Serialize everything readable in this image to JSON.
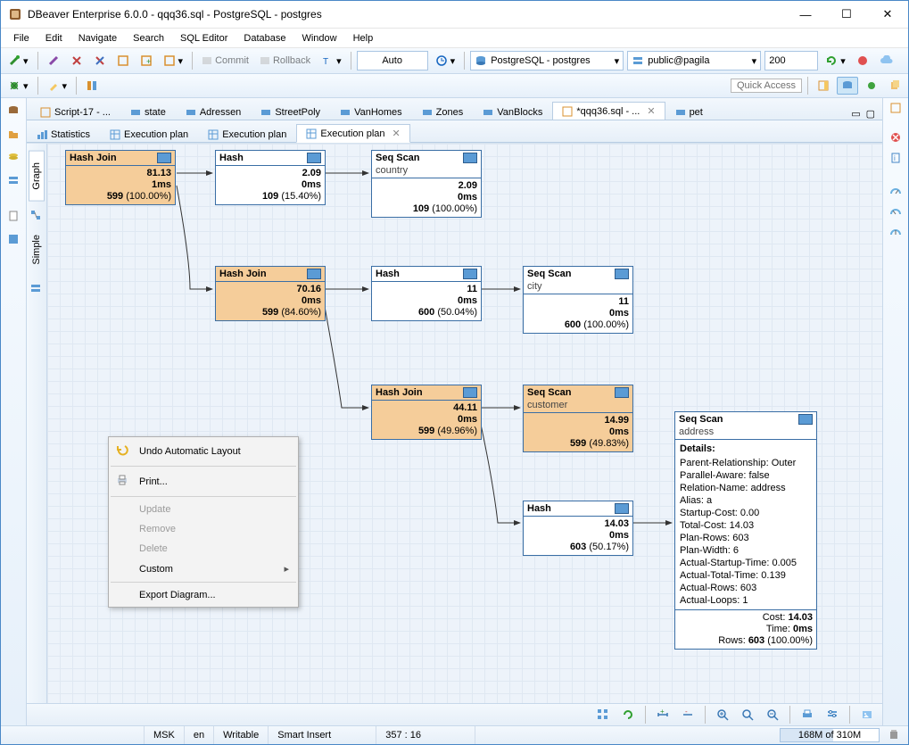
{
  "title": "DBeaver Enterprise 6.0.0 - qqq36.sql - PostgreSQL - postgres",
  "menu": [
    "File",
    "Edit",
    "Navigate",
    "Search",
    "SQL Editor",
    "Database",
    "Window",
    "Help"
  ],
  "toolbar": {
    "commit": "Commit",
    "rollback": "Rollback",
    "auto": "Auto",
    "datasource": "PostgreSQL - postgres",
    "schema": "public@pagila",
    "limit": "200"
  },
  "quick_access": "Quick Access",
  "editorTabs": [
    {
      "label": "Script-17 - ..."
    },
    {
      "label": "state"
    },
    {
      "label": "Adressen"
    },
    {
      "label": "StreetPoly"
    },
    {
      "label": "VanHomes"
    },
    {
      "label": "Zones"
    },
    {
      "label": "VanBlocks"
    },
    {
      "label": "*qqq36.sql - ...",
      "active": true,
      "closable": true
    },
    {
      "label": "pet"
    }
  ],
  "subTabs": [
    {
      "label": "Statistics"
    },
    {
      "label": "Execution plan"
    },
    {
      "label": "Execution plan"
    },
    {
      "label": "Execution plan",
      "active": true,
      "closable": true
    }
  ],
  "vert": {
    "graph": "Graph",
    "simple": "Simple"
  },
  "context": {
    "undo": "Undo Automatic Layout",
    "print": "Print...",
    "update": "Update",
    "remove": "Remove",
    "delete": "Delete",
    "custom": "Custom",
    "export": "Export Diagram..."
  },
  "nodes": {
    "hj1": {
      "title": "Hash Join",
      "v1": "81.13",
      "v2": "1ms",
      "v3": "599",
      "v3p": "(100.00%)"
    },
    "h1": {
      "title": "Hash",
      "v1": "2.09",
      "v2": "0ms",
      "v3": "109",
      "v3p": "(15.40%)"
    },
    "ss1": {
      "title": "Seq Scan",
      "sub": "country",
      "v1": "2.09",
      "v2": "0ms",
      "v3": "109",
      "v3p": "(100.00%)"
    },
    "hj2": {
      "title": "Hash Join",
      "v1": "70.16",
      "v2": "0ms",
      "v3": "599",
      "v3p": "(84.60%)"
    },
    "h2": {
      "title": "Hash",
      "v1": "11",
      "v2": "0ms",
      "v3": "600",
      "v3p": "(50.04%)"
    },
    "ss2": {
      "title": "Seq Scan",
      "sub": "city",
      "v1": "11",
      "v2": "0ms",
      "v3": "600",
      "v3p": "(100.00%)"
    },
    "hj3": {
      "title": "Hash Join",
      "v1": "44.11",
      "v2": "0ms",
      "v3": "599",
      "v3p": "(49.96%)"
    },
    "ss3": {
      "title": "Seq Scan",
      "sub": "customer",
      "v1": "14.99",
      "v2": "0ms",
      "v3": "599",
      "v3p": "(49.83%)"
    },
    "h3": {
      "title": "Hash",
      "v1": "14.03",
      "v2": "0ms",
      "v3": "603",
      "v3p": "(50.17%)"
    },
    "detail": {
      "title": "Seq Scan",
      "sub": "address",
      "details_label": "Details:",
      "lines": [
        "Parent-Relationship: Outer",
        "Parallel-Aware: false",
        "Relation-Name: address",
        "Alias: a",
        "Startup-Cost: 0.00",
        "Total-Cost: 14.03",
        "Plan-Rows: 603",
        "Plan-Width: 6",
        "Actual-Startup-Time: 0.005",
        "Actual-Total-Time: 0.139",
        "Actual-Rows: 603",
        "Actual-Loops: 1"
      ],
      "cost_l": "Cost:",
      "cost_v": "14.03",
      "time_l": "Time:",
      "time_v": "0ms",
      "rows_l": "Rows:",
      "rows_v": "603",
      "rows_p": "(100.00%)"
    }
  },
  "status": {
    "tz": "MSK",
    "lang": "en",
    "mode": "Writable",
    "insert": "Smart Insert",
    "pos": "357 : 16",
    "mem": "168M of 310M"
  }
}
